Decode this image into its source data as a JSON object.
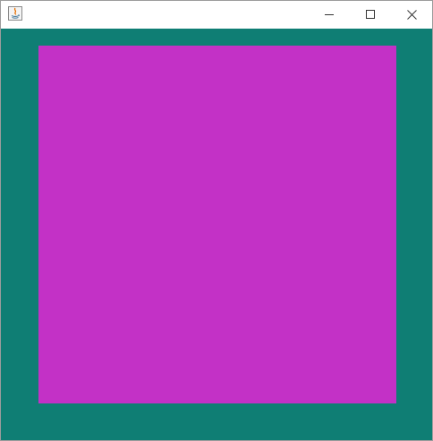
{
  "window": {
    "title": "",
    "app_icon": "java-icon",
    "controls": {
      "minimize_icon": "minimize-icon",
      "maximize_icon": "maximize-icon",
      "close_icon": "close-icon"
    }
  },
  "canvas": {
    "background_color": "#0f7e74",
    "square_color": "#c331c6"
  }
}
